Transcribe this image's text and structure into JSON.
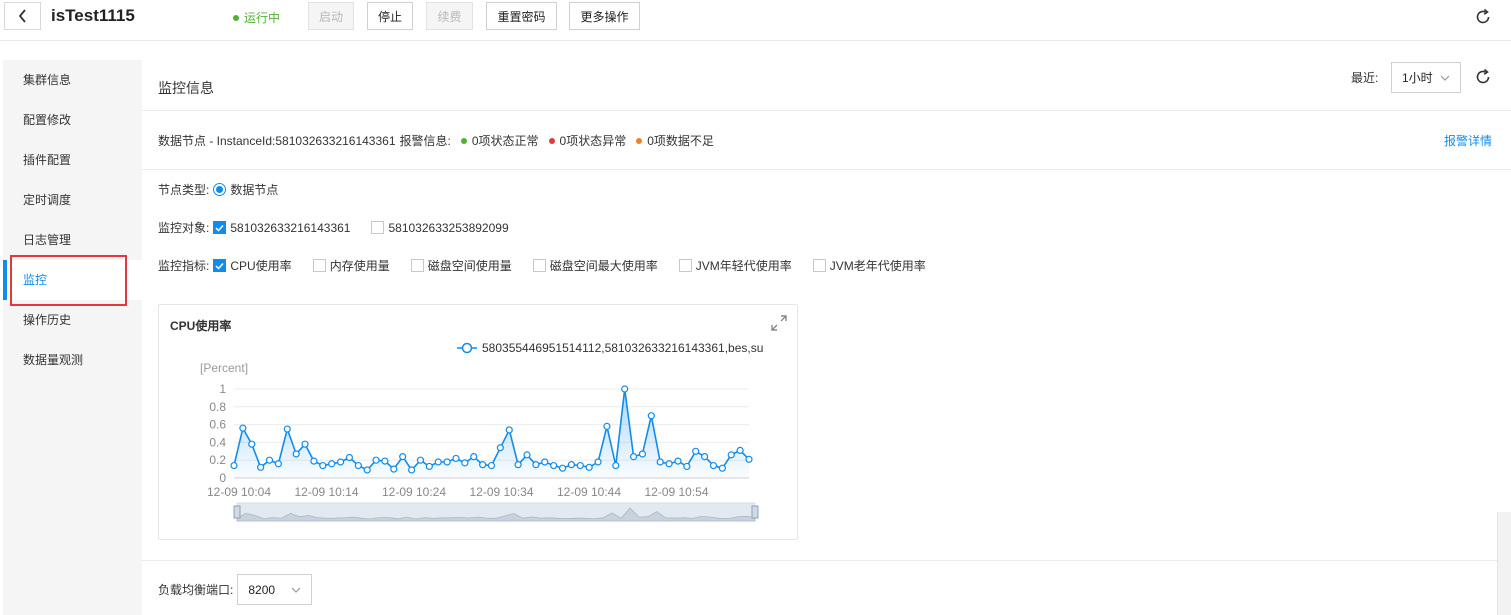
{
  "header": {
    "title": "isTest1115",
    "status": "运行中",
    "status_color": "#52b035",
    "buttons": [
      {
        "label": "启动",
        "disabled": true
      },
      {
        "label": "停止",
        "disabled": false
      },
      {
        "label": "续费",
        "disabled": true
      },
      {
        "label": "重置密码",
        "disabled": false
      },
      {
        "label": "更多操作",
        "disabled": false
      }
    ]
  },
  "sidebar": {
    "items": [
      {
        "label": "集群信息"
      },
      {
        "label": "配置修改"
      },
      {
        "label": "插件配置"
      },
      {
        "label": "定时调度"
      },
      {
        "label": "日志管理"
      },
      {
        "label": "监控",
        "active": true
      },
      {
        "label": "操作历史"
      },
      {
        "label": "数据量观测"
      }
    ],
    "accent": "#108cee"
  },
  "main": {
    "section_title": "监控信息",
    "recent_label": "最近:",
    "recent_value": "1小时",
    "info": {
      "prefix": "数据节点 - InstanceId:",
      "instance_id": "581032633216143361",
      "alarm_label": "报警信息:",
      "normal": "0项状态正常",
      "abnormal": "0项状态异常",
      "insufficient": "0项数据不足",
      "normal_color": "#52b035",
      "abnormal_color": "#e4393c",
      "insufficient_color": "#f0812c",
      "details_link": "报警详情"
    },
    "node_type": {
      "label": "节点类型:",
      "option": "数据节点"
    },
    "monitor_target": {
      "label": "监控对象:",
      "options": [
        {
          "label": "581032633216143361",
          "checked": true
        },
        {
          "label": "581032633253892099",
          "checked": false
        }
      ]
    },
    "monitor_metric": {
      "label": "监控指标:",
      "options": [
        {
          "label": "CPU使用率",
          "checked": true
        },
        {
          "label": "内存使用量",
          "checked": false
        },
        {
          "label": "磁盘空间使用量",
          "checked": false
        },
        {
          "label": "磁盘空间最大使用率",
          "checked": false
        },
        {
          "label": "JVM年轻代使用率",
          "checked": false
        },
        {
          "label": "JVM老年代使用率",
          "checked": false
        }
      ]
    },
    "chart_card_title": "CPU使用率",
    "lb_port": {
      "label": "负载均衡端口:",
      "value": "8200"
    }
  },
  "chart_data": {
    "type": "line",
    "ylabel": "[Percent]",
    "ylim": [
      0,
      1
    ],
    "yticks": [
      "0",
      "0.2",
      "0.4",
      "0.6",
      "0.8",
      "1"
    ],
    "xticks": [
      "12-09 10:04",
      "12-09 10:14",
      "12-09 10:24",
      "12-09 10:34",
      "12-09 10:44",
      "12-09 10:54"
    ],
    "series": [
      {
        "name": "580355446951514112,581032633216143361,bes,su",
        "color": "#108cee",
        "values": [
          0.14,
          0.56,
          0.38,
          0.12,
          0.2,
          0.16,
          0.55,
          0.27,
          0.38,
          0.19,
          0.14,
          0.16,
          0.18,
          0.23,
          0.14,
          0.09,
          0.2,
          0.19,
          0.1,
          0.24,
          0.09,
          0.2,
          0.13,
          0.18,
          0.18,
          0.22,
          0.17,
          0.24,
          0.15,
          0.14,
          0.34,
          0.54,
          0.15,
          0.26,
          0.15,
          0.18,
          0.14,
          0.11,
          0.15,
          0.14,
          0.12,
          0.18,
          0.58,
          0.14,
          1.0,
          0.24,
          0.27,
          0.7,
          0.18,
          0.16,
          0.19,
          0.13,
          0.3,
          0.24,
          0.14,
          0.11,
          0.26,
          0.31,
          0.21
        ]
      }
    ],
    "legend_position": "top-right",
    "grid": true
  }
}
